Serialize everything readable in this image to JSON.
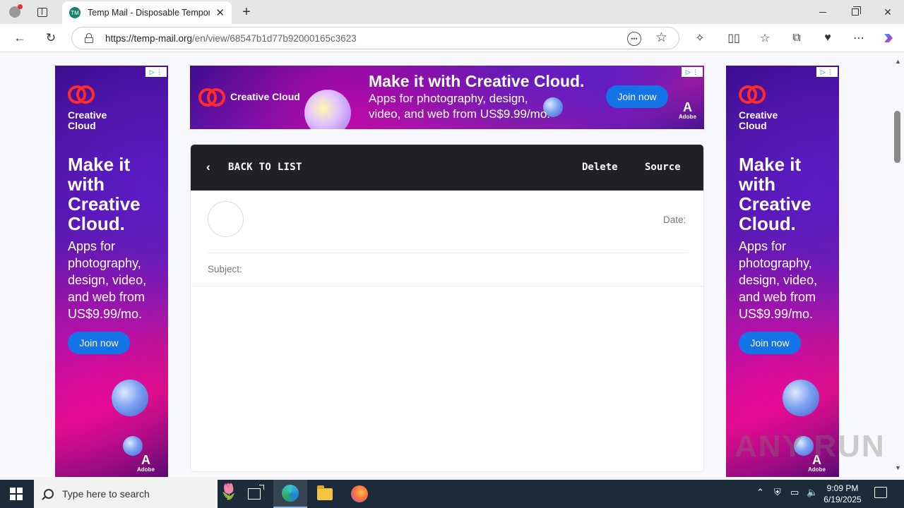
{
  "browser": {
    "tab_title": "Temp Mail - Disposable Tempora",
    "tab_favicon_text": "TM",
    "url_host": "https://temp-mail.org",
    "url_path": "/en/view/68547b1d77b92000165c3623"
  },
  "ads": {
    "brand_line1": "Creative",
    "brand_line2": "Cloud",
    "brand_full": "Creative Cloud",
    "headline_lines": [
      "Make it",
      "with",
      "Creative",
      "Cloud."
    ],
    "sub_lines": [
      "Apps for",
      "photography,",
      "design, video,",
      "and web from",
      "US$9.99/mo."
    ],
    "top_headline": "Make it with Creative Cloud.",
    "top_sub_line1": "Apps for photography, design,",
    "top_sub_line2": "video, and web from US$9.99/mo.",
    "join_label": "Join now",
    "adobe_label": "Adobe"
  },
  "mail": {
    "back_label": "BACK TO LIST",
    "delete_label": "Delete",
    "source_label": "Source",
    "date_label": "Date:",
    "subject_label": "Subject:"
  },
  "watermark": "ANY RUN",
  "taskbar": {
    "search_placeholder": "Type here to search",
    "time": "9:09 PM",
    "date": "6/19/2025"
  },
  "icons": {
    "profile": "profile-icon",
    "back": "back-arrow-icon",
    "reload": "reload-icon",
    "star": "favorite-star-icon",
    "extensions": "extensions-icon",
    "copilot": "copilot-icon"
  },
  "colors": {
    "mail_bar": "#1f2125",
    "join_button": "#1473e6",
    "taskbar": "#1c2b3a"
  }
}
